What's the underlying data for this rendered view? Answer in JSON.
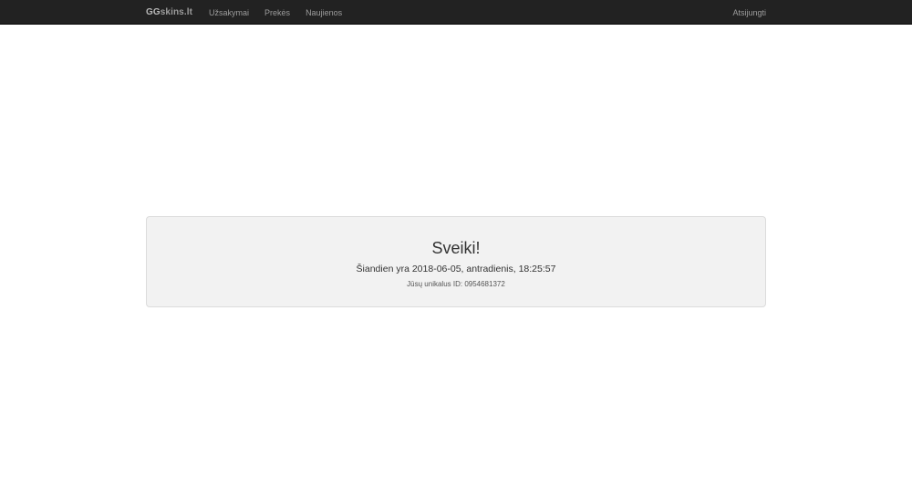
{
  "navbar": {
    "brand_prefix": "GG",
    "brand_suffix": "skins.lt",
    "links": [
      "Užsakymai",
      "Prekės",
      "Naujienos"
    ],
    "logout_label": "Atsijungti"
  },
  "main": {
    "greeting": "Sveiki!",
    "date_line": "Šiandien yra 2018-06-05, antradienis, 18:25:57",
    "id_line": "Jūsų unikalus ID: 0954681372"
  },
  "colors": {
    "navbar_bg": "#222222",
    "nav_text": "#9d9d9d",
    "panel_bg": "#f2f2f2"
  }
}
